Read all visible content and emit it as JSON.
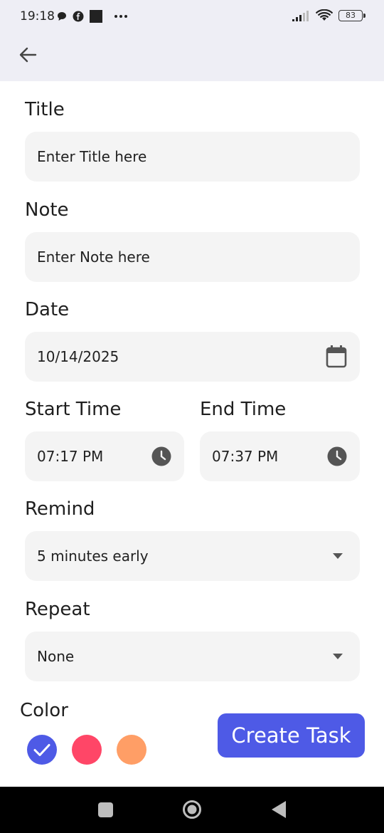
{
  "status_bar": {
    "time": "19:18",
    "battery": "83"
  },
  "form": {
    "title": {
      "label": "Title",
      "placeholder": "Enter Title here"
    },
    "note": {
      "label": "Note",
      "placeholder": "Enter Note here"
    },
    "date": {
      "label": "Date",
      "value": "10/14/2025"
    },
    "start_time": {
      "label": "Start Time",
      "value": "07:17 PM"
    },
    "end_time": {
      "label": "End Time",
      "value": "07:37 PM"
    },
    "remind": {
      "label": "Remind",
      "value": "5 minutes early"
    },
    "repeat": {
      "label": "Repeat",
      "value": "None"
    }
  },
  "color_picker": {
    "label": "Color",
    "options": [
      "#4e5ae6",
      "#ff4667",
      "#ff9e66"
    ],
    "selected_index": 0
  },
  "create_button": {
    "label": "Create Task"
  },
  "colors": {
    "accent": "#4e5ae6",
    "field_bg": "#f4f4f4",
    "header_bg": "#eeeef5"
  }
}
